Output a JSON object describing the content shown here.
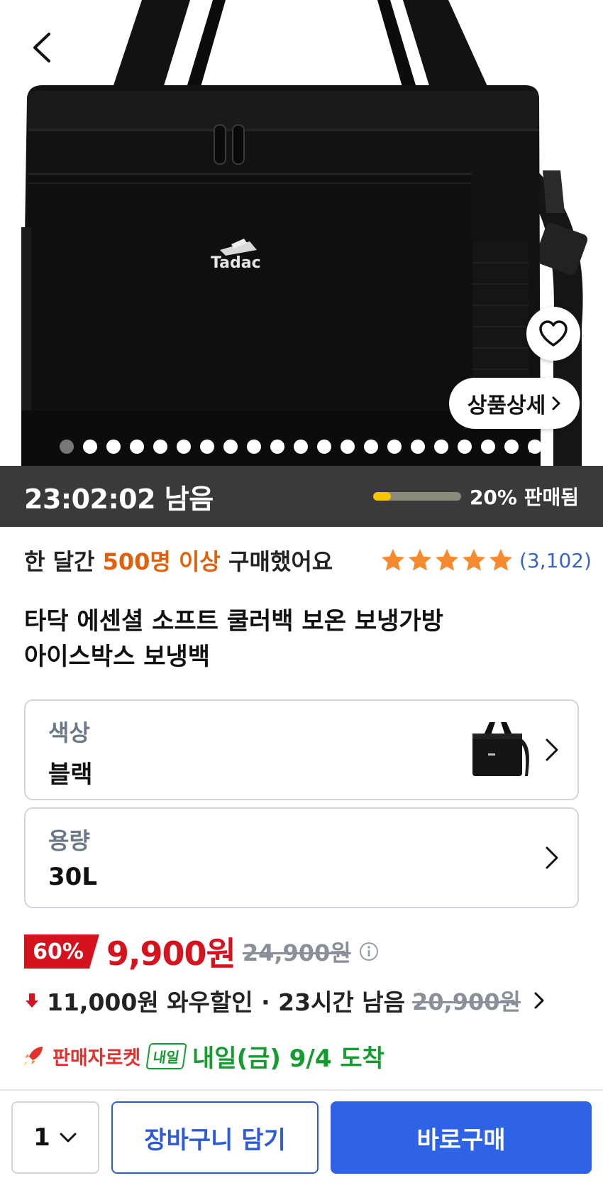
{
  "hero": {
    "brand_logo_text": "Tadac",
    "detail_button_label": "상품상세",
    "image_count": 21,
    "active_index": 0
  },
  "timer": {
    "remaining": "23:02:02 남음",
    "sold_fraction": 0.2,
    "sold_label": "20% 판매됨"
  },
  "social_proof": {
    "prefix": "한 달간 ",
    "highlight": "500명 이상",
    "suffix": " 구매했어요",
    "rating": 5,
    "review_count": "(3,102)"
  },
  "product": {
    "title_line1": "타닥 에센셜 소프트 쿨러백 보온 보냉가방",
    "title_line2": "아이스박스 보냉백"
  },
  "options": {
    "color": {
      "label": "색상",
      "value": "블랙"
    },
    "capacity": {
      "label": "용량",
      "value": "30L"
    }
  },
  "price": {
    "discount": "60%",
    "current": "9,900원",
    "original": "24,900원",
    "wow_discount": "11,000원 와우할인 · 23시간 남음",
    "wow_original": "20,900원"
  },
  "shipping": {
    "rocket_label": "판매자로켓",
    "tomorrow_badge": "내일",
    "arrival": "내일(금) 9/4 도착"
  },
  "bottom_bar": {
    "quantity": "1",
    "cart_label": "장바구니 담기",
    "buy_label": "바로구매"
  },
  "colors": {
    "accent_blue": "#2f63e6",
    "price_red": "#d4131f",
    "highlight_orange": "#e0600c",
    "delivery_green": "#159c2f",
    "star_orange": "#f58b2e",
    "timer_bg": "#3a3a3a",
    "progress_yellow": "#f7c600"
  }
}
